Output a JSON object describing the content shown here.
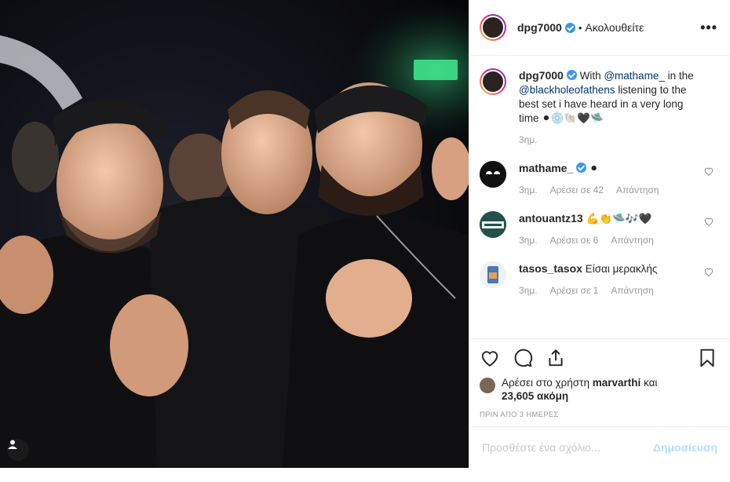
{
  "post": {
    "author": "dpg7000",
    "follow_state": "Ακολουθείτε",
    "separator": "•",
    "more_glyph": "•••"
  },
  "caption": {
    "author": "dpg7000",
    "text_1": "With",
    "mention_1": "@mathame_",
    "text_2": "in the",
    "mention_2": "@blackholeofathens",
    "text_3": "listening to the best set i have heard in a very long time",
    "emojis": "⚫💿🐚🖤🛸",
    "age": "3ημ."
  },
  "comments": [
    {
      "user": "mathame_",
      "verified": true,
      "text": "⚫",
      "age": "3ημ.",
      "likes": "Αρέσει σε 42",
      "reply": "Απάντηση"
    },
    {
      "user": "antouantz13",
      "verified": false,
      "text": "💪👏🛸🎶🖤",
      "age": "3ημ.",
      "likes": "Αρέσει σε 6",
      "reply": "Απάντηση"
    },
    {
      "user": "tasos_tasox",
      "verified": false,
      "text": "Είσαι μερακλής",
      "age": "3ημ.",
      "likes": "Αρέσει σε 1",
      "reply": "Απάντηση"
    }
  ],
  "likes": {
    "prefix": "Αρέσει στο χρήστη",
    "user": "marvarthi",
    "conj": "και",
    "count": "23,605 ακόμη"
  },
  "timestamp": "ΠΡΙΝ ΑΠΟ 3 ΗΜΕΡΕΣ",
  "comment_box": {
    "placeholder": "Προσθέστε ένα σχόλιο...",
    "post_label": "Δημοσίευση"
  },
  "colors": {
    "link": "#003569",
    "verified": "#3897f0",
    "muted": "#999999",
    "post_disabled": "#b2dffc"
  },
  "icons": [
    "heart-icon",
    "comment-icon",
    "share-icon",
    "bookmark-icon",
    "user-tag-icon",
    "verified-icon"
  ]
}
